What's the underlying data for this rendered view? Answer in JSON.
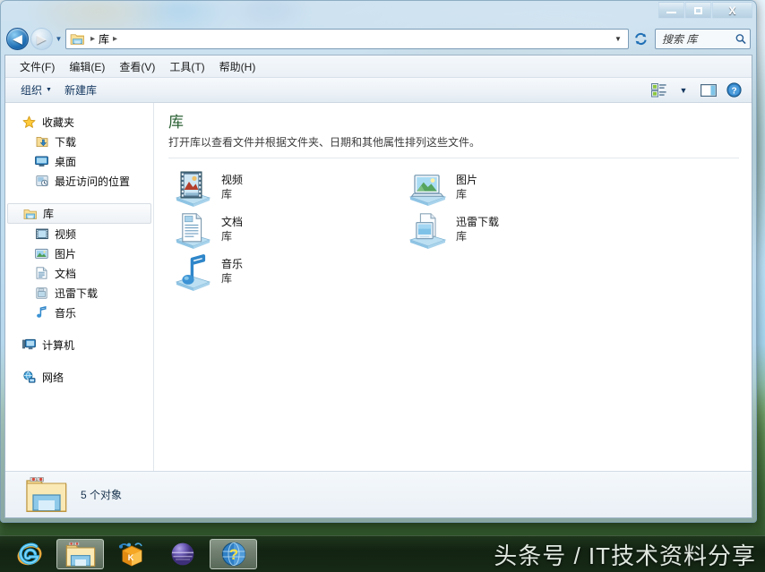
{
  "window": {
    "controls": {
      "minimize_label": "—",
      "maximize_label": "□",
      "close_label": "X"
    }
  },
  "address_bar": {
    "back_label": "◀",
    "forward_label": "▶",
    "recent_caret": "▼",
    "crumb_separator": "▸",
    "path_segments": [
      "库"
    ],
    "dropdown_caret": "▼",
    "refresh_title": "刷新",
    "search_placeholder": "搜索 库"
  },
  "menu_bar": {
    "items": [
      {
        "label": "文件(F)"
      },
      {
        "label": "编辑(E)"
      },
      {
        "label": "查看(V)"
      },
      {
        "label": "工具(T)"
      },
      {
        "label": "帮助(H)"
      }
    ]
  },
  "command_bar": {
    "organize_label": "组织",
    "organize_caret": "▼",
    "new_library_label": "新建库",
    "view_caret": "▼"
  },
  "nav_pane": {
    "groups": [
      {
        "header": {
          "label": "收藏夹",
          "icon": "star-icon"
        },
        "items": [
          {
            "label": "下载",
            "icon": "downloads-icon"
          },
          {
            "label": "桌面",
            "icon": "desktop-icon"
          },
          {
            "label": "最近访问的位置",
            "icon": "recent-places-icon"
          }
        ]
      },
      {
        "header": {
          "label": "库",
          "icon": "library-folder-icon",
          "selected": true
        },
        "items": [
          {
            "label": "视频",
            "icon": "video-icon"
          },
          {
            "label": "图片",
            "icon": "pictures-icon"
          },
          {
            "label": "文档",
            "icon": "documents-icon"
          },
          {
            "label": "迅雷下载",
            "icon": "thunder-download-icon"
          },
          {
            "label": "音乐",
            "icon": "music-icon"
          }
        ]
      },
      {
        "header": {
          "label": "计算机",
          "icon": "computer-icon"
        },
        "items": []
      },
      {
        "header": {
          "label": "网络",
          "icon": "network-icon"
        },
        "items": []
      }
    ]
  },
  "content": {
    "title": "库",
    "subtitle": "打开库以查看文件并根据文件夹、日期和其他属性排列这些文件。",
    "items": [
      {
        "name": "视频",
        "kind": "库",
        "icon": "video-library-icon"
      },
      {
        "name": "图片",
        "kind": "库",
        "icon": "pictures-library-icon"
      },
      {
        "name": "文档",
        "kind": "库",
        "icon": "documents-library-icon"
      },
      {
        "name": "迅雷下载",
        "kind": "库",
        "icon": "thunder-library-icon"
      },
      {
        "name": "音乐",
        "kind": "库",
        "icon": "music-library-icon"
      }
    ]
  },
  "details_pane": {
    "icon": "libraries-folder-icon",
    "text": "5 个对象"
  },
  "taskbar": {
    "buttons": [
      {
        "name": "internet-explorer",
        "active": false
      },
      {
        "name": "windows-explorer",
        "active": true
      },
      {
        "name": "kugou-music",
        "active": false
      },
      {
        "name": "purple-app",
        "active": false
      },
      {
        "name": "help-globe",
        "active": true
      }
    ],
    "watermark": "头条号 / IT技术资料分享"
  },
  "colors": {
    "title_green": "#2a6033",
    "accent_blue": "#1f6fb5",
    "selection": "#cde4f7"
  }
}
